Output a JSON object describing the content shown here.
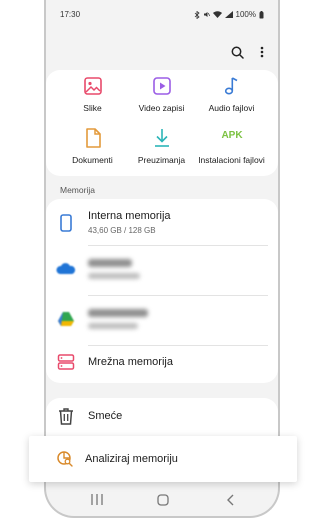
{
  "status_bar": {
    "time": "17:30",
    "battery": "100%"
  },
  "toolbar": {
    "search_icon": "search-icon",
    "more_icon": "more-vertical-icon"
  },
  "categories": [
    {
      "label": "Slike",
      "icon": "image-icon",
      "color": "#e84a6b"
    },
    {
      "label": "Video zapisi",
      "icon": "video-icon",
      "color": "#9b5de5"
    },
    {
      "label": "Audio fajlovi",
      "icon": "music-note-icon",
      "color": "#3a7bd5"
    },
    {
      "label": "Dokumenti",
      "icon": "document-icon",
      "color": "#e39a3b"
    },
    {
      "label": "Preuzimanja",
      "icon": "download-icon",
      "color": "#2bb5b8"
    },
    {
      "label": "Instalacioni fajlovi",
      "icon": "apk-icon",
      "icon_text": "APK",
      "color": "#7cc242"
    }
  ],
  "storage": {
    "section_label": "Memorija",
    "internal": {
      "title": "Interna memorija",
      "subtitle": "43,60 GB / 128 GB"
    },
    "network_label": "Mrežna memorija"
  },
  "trash": {
    "label": "Smeće"
  },
  "analyze": {
    "label": "Analiziraj memoriju"
  },
  "nav": {
    "recents": "recents-icon",
    "home": "home-icon",
    "back": "back-icon"
  }
}
